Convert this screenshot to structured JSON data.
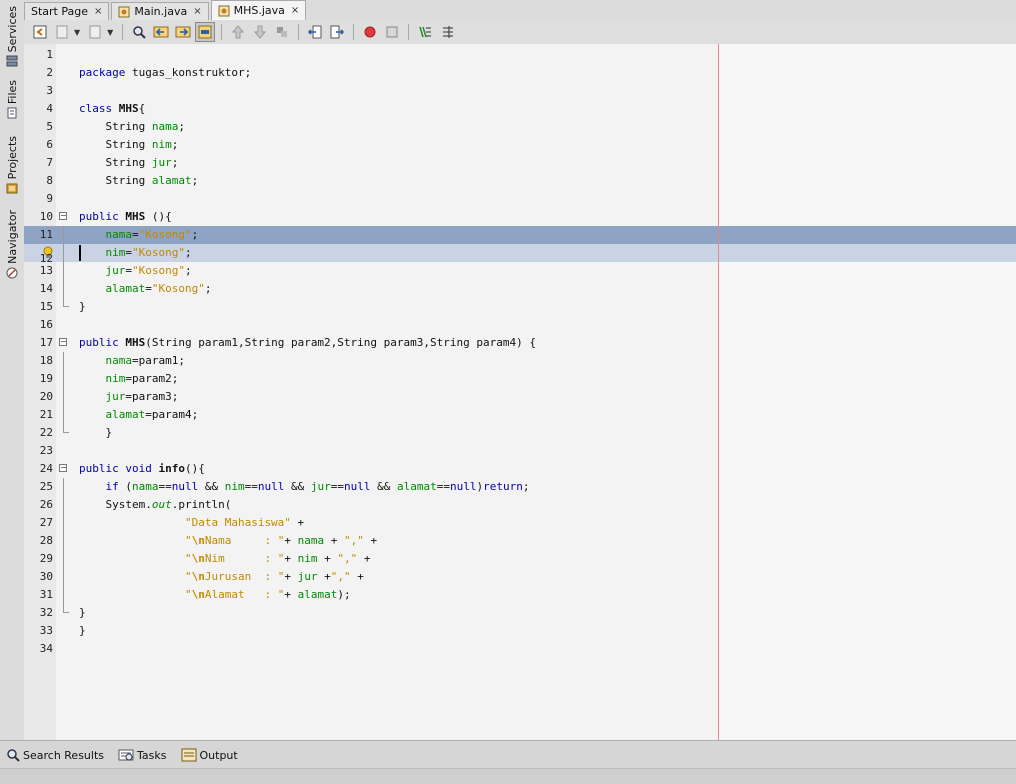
{
  "sidebar": {
    "items": [
      {
        "label": "Services"
      },
      {
        "label": "Files"
      },
      {
        "label": "Projects"
      },
      {
        "label": "Navigator"
      }
    ]
  },
  "tabs": [
    {
      "label": "Start Page",
      "close": "×"
    },
    {
      "label": "Main.java",
      "close": "×"
    },
    {
      "label": "MHS.java",
      "close": "×"
    }
  ],
  "editor": {
    "lines": [
      {
        "n": "1"
      },
      {
        "n": "2"
      },
      {
        "n": "3"
      },
      {
        "n": "4"
      },
      {
        "n": "5"
      },
      {
        "n": "6"
      },
      {
        "n": "7"
      },
      {
        "n": "8"
      },
      {
        "n": "9"
      },
      {
        "n": "10"
      },
      {
        "n": "11"
      },
      {
        "n": "12"
      },
      {
        "n": "13"
      },
      {
        "n": "14"
      },
      {
        "n": "15"
      },
      {
        "n": "16"
      },
      {
        "n": "17"
      },
      {
        "n": "18"
      },
      {
        "n": "19"
      },
      {
        "n": "20"
      },
      {
        "n": "21"
      },
      {
        "n": "22"
      },
      {
        "n": "23"
      },
      {
        "n": "24"
      },
      {
        "n": "25"
      },
      {
        "n": "26"
      },
      {
        "n": "27"
      },
      {
        "n": "28"
      },
      {
        "n": "29"
      },
      {
        "n": "30"
      },
      {
        "n": "31"
      },
      {
        "n": "32"
      },
      {
        "n": "33"
      },
      {
        "n": "34"
      }
    ],
    "code": {
      "l2_kw": "package",
      "l2_rest": " tugas_konstruktor;",
      "l4_kw": "class",
      "l4_name": "MHS",
      "l4_rest": "{",
      "type_string": "String",
      "f_nama": "nama",
      "f_nim": "nim",
      "f_jur": "jur",
      "f_alamat": "alamat",
      "semi": ";",
      "l10_kw": "public",
      "l10_name": "MHS",
      "l10_rest": " (){",
      "eq": "=",
      "s_kosong": "\"Kosong\"",
      "close_brace": "}",
      "l17_kw": "public",
      "l17_name": "MHS",
      "l17_rest": "(String param1,String param2,String param3,String param4) {",
      "p1": "=param1;",
      "p2": "=param2;",
      "p3": "=param3;",
      "p4": "=param4;",
      "l24_kw": "public",
      "l24_void": "void",
      "l24_name": "info",
      "l24_rest": "(){",
      "l25_if": "if",
      "l25_a": " (",
      "l25_b": "==",
      "l25_null": "null",
      "l25_and": " && ",
      "l25_close": ")",
      "l25_ret": "return",
      "l25_end": ";",
      "l26_a": "System.",
      "l26_out": "out",
      "l26_b": ".println(",
      "l27_str": "\"Data Mahasiswa\"",
      "l27_rest": " +",
      "q": "\"",
      "esc_n": "\\n",
      "l28_lbl": "Nama     : ",
      "l28_a": "+ ",
      "l28_b": " + ",
      "l28_c": "\",\"",
      "l28_d": " +",
      "l29_lbl": "Nim      : ",
      "l30_lbl": "Jurusan  : ",
      "l30_b": " +",
      "l31_lbl": "Alamat   : ",
      "l31_end": ");"
    }
  },
  "bottom": {
    "tabs": [
      {
        "label": "Search Results"
      },
      {
        "label": "Tasks"
      },
      {
        "label": "Output"
      }
    ]
  },
  "colors": {
    "keyword": "#0000b4",
    "field": "#008a00",
    "string": "#c08a00",
    "selection": "#8fa3c4",
    "current_line": "#c9d3e3",
    "margin_line": "#e08a8a"
  }
}
